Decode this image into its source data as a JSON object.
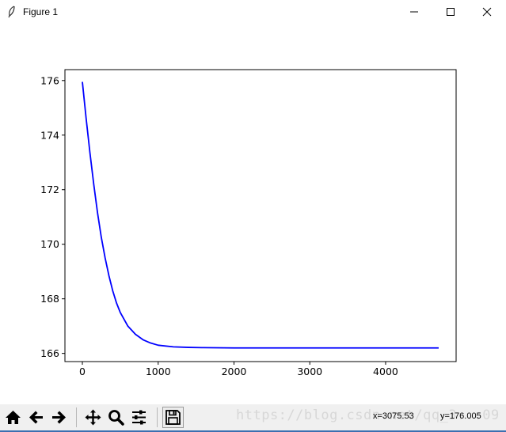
{
  "window": {
    "title": "Figure 1",
    "icons": [
      "feather-icon",
      "minimize-icon",
      "maximize-icon",
      "close-icon"
    ]
  },
  "toolbar": {
    "icons": [
      "home-icon",
      "back-arrow-icon",
      "forward-arrow-icon",
      "pan-icon",
      "zoom-icon",
      "configure-subplots-icon",
      "save-icon"
    ],
    "watermark": "https://blog.csdn.net/qq_3...09",
    "coord_x": "x=3075.53",
    "coord_y": "y=176.005"
  },
  "colors": {
    "line": "#0000ff",
    "toolbar_bg": "#f0f0f0"
  },
  "chart_data": {
    "type": "line",
    "title": "",
    "xlabel": "",
    "ylabel": "",
    "xlim": [
      -230,
      4930
    ],
    "ylim": [
      165.7,
      176.4
    ],
    "xticks": [
      0,
      1000,
      2000,
      3000,
      4000
    ],
    "xtick_labels": [
      "0",
      "1000",
      "2000",
      "3000",
      "4000"
    ],
    "yticks": [
      166,
      168,
      170,
      172,
      174,
      176
    ],
    "ytick_labels": [
      "166",
      "168",
      "170",
      "172",
      "174",
      "176"
    ],
    "grid": false,
    "series": [
      {
        "x": [
          0,
          50,
          100,
          150,
          200,
          250,
          300,
          350,
          400,
          450,
          500,
          600,
          700,
          800,
          900,
          1000,
          1200,
          1400,
          1600,
          2000,
          2500,
          3000,
          3500,
          4000,
          4500,
          4700
        ],
        "y": [
          175.95,
          174.6,
          173.35,
          172.2,
          171.15,
          170.25,
          169.5,
          168.85,
          168.3,
          167.85,
          167.5,
          167.0,
          166.7,
          166.5,
          166.38,
          166.3,
          166.24,
          166.22,
          166.21,
          166.2,
          166.2,
          166.2,
          166.2,
          166.2,
          166.2,
          166.2
        ]
      }
    ]
  }
}
